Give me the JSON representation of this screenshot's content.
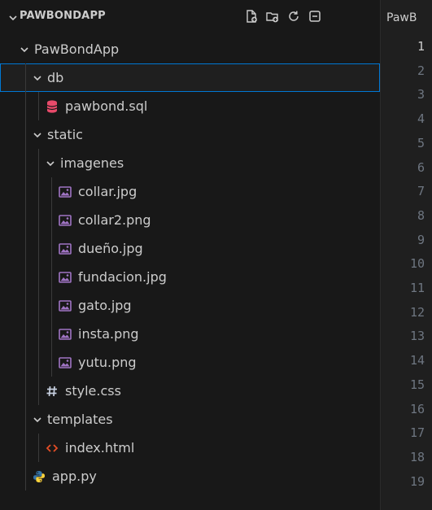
{
  "explorer": {
    "title": "PAWBONDAPP",
    "actions": [
      {
        "name": "new-file-icon"
      },
      {
        "name": "new-folder-icon"
      },
      {
        "name": "refresh-icon"
      },
      {
        "name": "collapse-all-icon"
      }
    ],
    "tree": [
      {
        "label": "PawBondApp",
        "type": "folder",
        "depth": 0,
        "expanded": true,
        "name": "folder-pawbondapp"
      },
      {
        "label": "db",
        "type": "folder",
        "depth": 1,
        "expanded": true,
        "selected": true,
        "name": "folder-db"
      },
      {
        "label": "pawbond.sql",
        "type": "file",
        "icon": "database-icon",
        "depth": 2,
        "name": "file-pawbond-sql"
      },
      {
        "label": "static",
        "type": "folder",
        "depth": 1,
        "expanded": true,
        "name": "folder-static"
      },
      {
        "label": "imagenes",
        "type": "folder",
        "depth": 2,
        "expanded": true,
        "name": "folder-imagenes"
      },
      {
        "label": "collar.jpg",
        "type": "file",
        "icon": "image-icon",
        "depth": 3,
        "name": "file-collar-jpg"
      },
      {
        "label": "collar2.png",
        "type": "file",
        "icon": "image-icon",
        "depth": 3,
        "name": "file-collar2-png"
      },
      {
        "label": "dueño.jpg",
        "type": "file",
        "icon": "image-icon",
        "depth": 3,
        "name": "file-dueno-jpg"
      },
      {
        "label": "fundacion.jpg",
        "type": "file",
        "icon": "image-icon",
        "depth": 3,
        "name": "file-fundacion-jpg"
      },
      {
        "label": "gato.jpg",
        "type": "file",
        "icon": "image-icon",
        "depth": 3,
        "name": "file-gato-jpg"
      },
      {
        "label": "insta.png",
        "type": "file",
        "icon": "image-icon",
        "depth": 3,
        "name": "file-insta-png"
      },
      {
        "label": "yutu.png",
        "type": "file",
        "icon": "image-icon",
        "depth": 3,
        "name": "file-yutu-png"
      },
      {
        "label": "style.css",
        "type": "file",
        "icon": "css-hash-icon",
        "depth": 2,
        "name": "file-style-css"
      },
      {
        "label": "templates",
        "type": "folder",
        "depth": 1,
        "expanded": true,
        "name": "folder-templates"
      },
      {
        "label": "index.html",
        "type": "file",
        "icon": "html-icon",
        "depth": 2,
        "name": "file-index-html"
      },
      {
        "label": "app.py",
        "type": "file",
        "icon": "python-icon",
        "depth": 1,
        "name": "file-app-py"
      }
    ]
  },
  "editor": {
    "tab_label": "PawB",
    "line_numbers": [
      "1",
      "2",
      "3",
      "4",
      "5",
      "6",
      "7",
      "8",
      "9",
      "10",
      "11",
      "12",
      "13",
      "14",
      "15",
      "16",
      "17",
      "18",
      "19"
    ],
    "active_line": "1"
  },
  "colors": {
    "selection_border": "#0078d4",
    "database_icon": "#e84a6a",
    "image_icon": "#a074c4",
    "css_icon": "#c7d0e0",
    "html_icon": "#e44d26",
    "python_blue": "#3572a5",
    "python_yellow": "#ffd43b"
  }
}
